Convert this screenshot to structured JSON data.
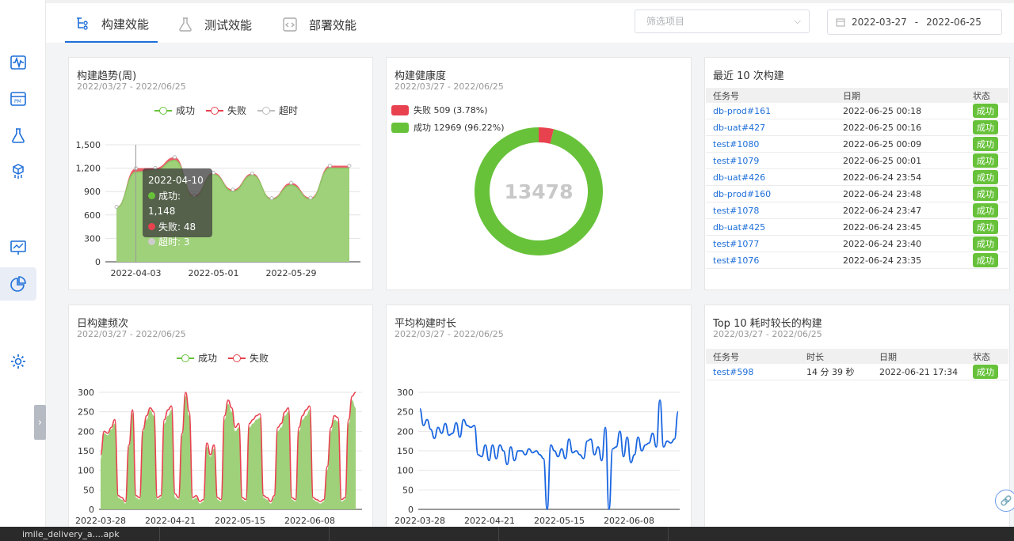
{
  "tabs": [
    {
      "label": "构建效能",
      "icon": "build-tree-icon",
      "active": true
    },
    {
      "label": "测试效能",
      "icon": "flask-icon",
      "active": false
    },
    {
      "label": "部署效能",
      "icon": "code-file-icon",
      "active": false
    }
  ],
  "filter": {
    "placeholder": "筛选项目"
  },
  "date_range": {
    "start": "2022-03-27",
    "separator": "-",
    "end": "2022-06-25"
  },
  "cards": {
    "build_trend": {
      "title": "构建趋势(周)",
      "subtitle": "2022/03/27 - 2022/06/25"
    },
    "build_health": {
      "title": "构建健康度",
      "subtitle": "2022/03/27 - 2022/06/25"
    },
    "recent_builds": {
      "title": "最近 10 次构建"
    },
    "daily_freq": {
      "title": "日构建频次",
      "subtitle": "2022/03/27 - 2022/06/25"
    },
    "avg_duration": {
      "title": "平均构建时长",
      "subtitle": "2022/03/27 - 2022/06/25"
    },
    "top10": {
      "title": "Top 10 耗时较长的构建",
      "subtitle": "2022/03/27 - 2022/06/25"
    }
  },
  "legend": {
    "success": "成功",
    "fail": "失败",
    "timeout": "超时"
  },
  "health_legend": {
    "fail": "失败 509 (3.78%)",
    "success": "成功 12969 (96.22%)"
  },
  "tooltip": {
    "date": "2022-04-10",
    "success": "成功: 1,148",
    "fail": "失败: 48",
    "timeout": "超时: 3"
  },
  "recent_table": {
    "headers": [
      "任务号",
      "日期",
      "状态"
    ],
    "rows": [
      {
        "task": "db-prod#161",
        "date": "2022-06-25 00:18",
        "status": "成功"
      },
      {
        "task": "db-uat#427",
        "date": "2022-06-25 00:16",
        "status": "成功"
      },
      {
        "task": "test#1080",
        "date": "2022-06-25 00:09",
        "status": "成功"
      },
      {
        "task": "test#1079",
        "date": "2022-06-25 00:01",
        "status": "成功"
      },
      {
        "task": "db-uat#426",
        "date": "2022-06-24 23:54",
        "status": "成功"
      },
      {
        "task": "db-prod#160",
        "date": "2022-06-24 23:48",
        "status": "成功"
      },
      {
        "task": "test#1078",
        "date": "2022-06-24 23:47",
        "status": "成功"
      },
      {
        "task": "db-uat#425",
        "date": "2022-06-24 23:45",
        "status": "成功"
      },
      {
        "task": "test#1077",
        "date": "2022-06-24 23:40",
        "status": "成功"
      },
      {
        "task": "test#1076",
        "date": "2022-06-24 23:35",
        "status": "成功"
      }
    ]
  },
  "top10_table": {
    "headers": [
      "任务号",
      "时长",
      "日期",
      "状态"
    ],
    "rows": [
      {
        "task": "test#598",
        "duration": "14 分 39 秒",
        "date": "2022-06-21 17:34",
        "status": "成功"
      }
    ]
  },
  "taskbar": {
    "item1": "imile_delivery_a....apk"
  },
  "colors": {
    "success": "#67c23a",
    "success_fill": "#9fd07a",
    "fail": "#e8424f",
    "timeout": "#bdbdbd",
    "accent": "#1e6fd9",
    "line_blue": "#1a66e0"
  },
  "chart_data": [
    {
      "type": "area",
      "id": "build_trend",
      "x": [
        "2022-03-27",
        "2022-04-03",
        "2022-04-10",
        "2022-04-17",
        "2022-04-24",
        "2022-05-01",
        "2022-05-08",
        "2022-05-15",
        "2022-05-22",
        "2022-05-29",
        "2022-06-05",
        "2022-06-12",
        "2022-06-19"
      ],
      "series": [
        {
          "name": "成功",
          "values": [
            690,
            1148,
            1170,
            1300,
            820,
            1120,
            900,
            1110,
            800,
            980,
            800,
            1200,
            1200
          ]
        },
        {
          "name": "失败",
          "values": [
            12,
            48,
            30,
            40,
            30,
            20,
            25,
            20,
            15,
            30,
            20,
            30,
            30
          ]
        },
        {
          "name": "超时",
          "values": [
            2,
            3,
            2,
            2,
            1,
            2,
            1,
            2,
            1,
            2,
            1,
            2,
            2
          ]
        }
      ],
      "x_ticks": [
        "2022-04-03",
        "2022-05-01",
        "2022-05-29"
      ],
      "ylim": [
        0,
        1500
      ],
      "yticks": [
        0,
        300,
        600,
        900,
        1200,
        1500
      ],
      "y_tick_labels": [
        "0",
        "300",
        "600",
        "900",
        "1,200",
        "1,500"
      ]
    },
    {
      "type": "pie",
      "id": "build_health",
      "center_label": "13478",
      "slices": [
        {
          "name": "失败",
          "value": 509
        },
        {
          "name": "成功",
          "value": 12969
        }
      ]
    },
    {
      "type": "area",
      "id": "daily_freq",
      "series": [
        {
          "name": "成功",
          "values": [
            130,
            195,
            190,
            205,
            220,
            30,
            25,
            15,
            160,
            245,
            30,
            25,
            200,
            230,
            255,
            240,
            25,
            30,
            220,
            240,
            255,
            30,
            25,
            190,
            290,
            240,
            25,
            30,
            15,
            20,
            160,
            135,
            155,
            25,
            20,
            230,
            270,
            250,
            200,
            210,
            25,
            20,
            210,
            220,
            230,
            235,
            30,
            25,
            15,
            30,
            200,
            210,
            240,
            250,
            25,
            20,
            200,
            230,
            240,
            255,
            25,
            20,
            15,
            20,
            100,
            200,
            230,
            225,
            20,
            25,
            220,
            280,
            260
          ]
        },
        {
          "name": "失败",
          "values": [
            140,
            200,
            195,
            210,
            230,
            35,
            30,
            20,
            165,
            255,
            35,
            30,
            205,
            240,
            260,
            250,
            30,
            35,
            230,
            255,
            265,
            40,
            30,
            195,
            300,
            250,
            30,
            35,
            20,
            25,
            170,
            140,
            165,
            30,
            25,
            240,
            280,
            260,
            210,
            220,
            30,
            25,
            220,
            230,
            240,
            245,
            35,
            30,
            20,
            35,
            210,
            220,
            250,
            260,
            30,
            25,
            210,
            240,
            255,
            265,
            30,
            25,
            20,
            25,
            110,
            210,
            240,
            235,
            25,
            30,
            230,
            290,
            300
          ]
        }
      ],
      "x_ticks": [
        "2022-03-28",
        "2022-04-21",
        "2022-05-15",
        "2022-06-08"
      ],
      "ylim": [
        0,
        300
      ],
      "yticks": [
        0,
        50,
        100,
        150,
        200,
        250,
        300
      ]
    },
    {
      "type": "line",
      "id": "avg_duration",
      "series": [
        {
          "name": "平均构建时长",
          "values": [
            258,
            215,
            230,
            205,
            182,
            210,
            195,
            220,
            190,
            195,
            222,
            185,
            230,
            215,
            210,
            215,
            140,
            135,
            165,
            125,
            165,
            130,
            165,
            150,
            115,
            160,
            125,
            150,
            150,
            140,
            155,
            145,
            150,
            140,
            130,
            0,
            165,
            150,
            135,
            155,
            130,
            180,
            145,
            150,
            140,
            130,
            175,
            180,
            140,
            160,
            125,
            210,
            0,
            155,
            160,
            200,
            135,
            185,
            120,
            140,
            185,
            150,
            165,
            170,
            195,
            160,
            280,
            160,
            175,
            170,
            180,
            250
          ]
        }
      ],
      "x_ticks": [
        "2022-03-28",
        "2022-04-21",
        "2022-05-15",
        "2022-06-08"
      ],
      "ylim": [
        0,
        300
      ],
      "yticks": [
        0,
        50,
        100,
        150,
        200,
        250,
        300
      ]
    }
  ]
}
